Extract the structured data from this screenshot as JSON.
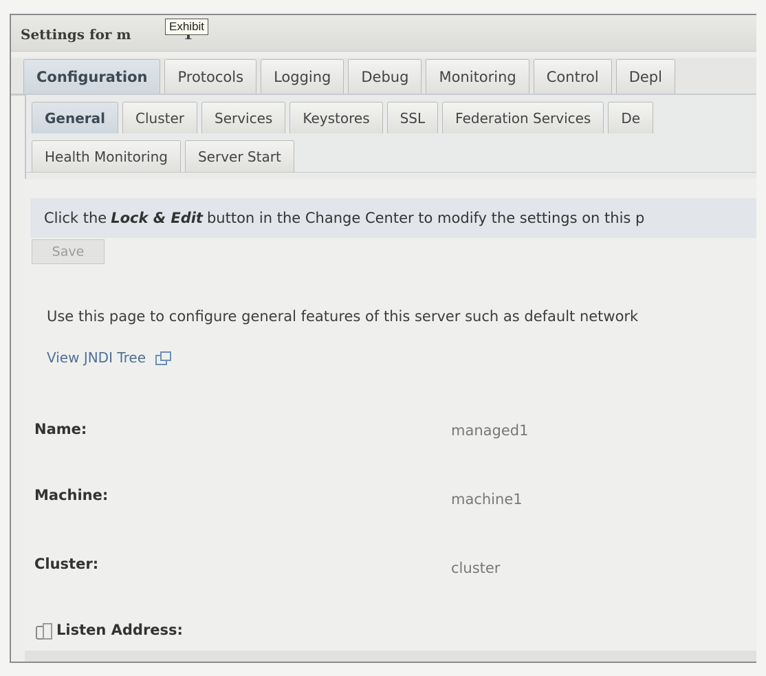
{
  "window": {
    "title": "Settings for managed1",
    "title_visible": "Settings for m",
    "title_tail": "1"
  },
  "tooltip": "Exhibit",
  "tabs": [
    "Configuration",
    "Protocols",
    "Logging",
    "Debug",
    "Monitoring",
    "Control",
    "Depl"
  ],
  "subtabs_row1": [
    "General",
    "Cluster",
    "Services",
    "Keystores",
    "SSL",
    "Federation Services",
    "De"
  ],
  "subtabs_row2": [
    "Health Monitoring",
    "Server Start"
  ],
  "notice": {
    "before": "Click the",
    "emph": "Lock & Edit",
    "after": "button in the Change Center to modify the settings on this p"
  },
  "save_label": "Save",
  "description": "Use this page to configure general features of this server such as default network",
  "jndi_link": "View JNDI Tree",
  "fields": [
    {
      "label": "Name:",
      "value": "managed1"
    },
    {
      "label": "Machine:",
      "value": "machine1"
    },
    {
      "label": "Cluster:",
      "value": "cluster"
    },
    {
      "label": "Listen Address:",
      "value": ""
    }
  ]
}
